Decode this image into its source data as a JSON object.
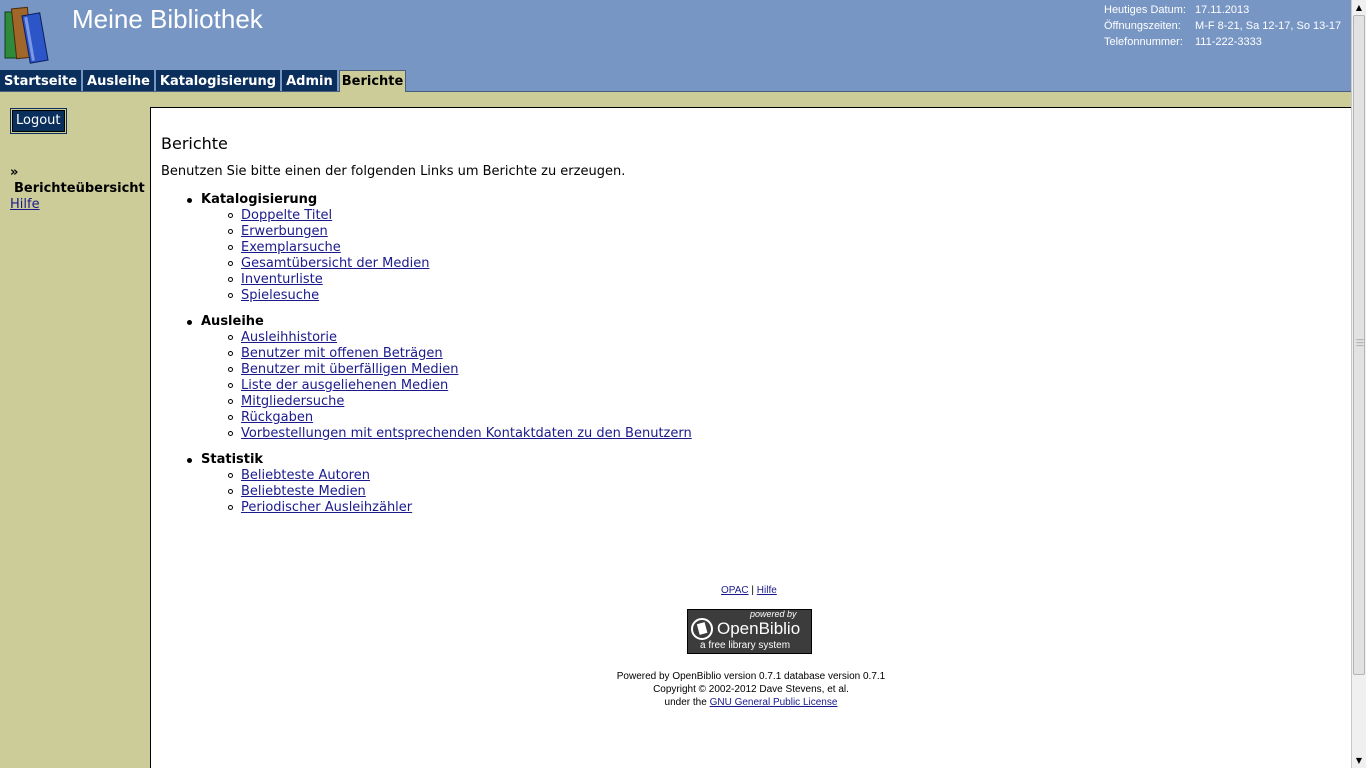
{
  "header": {
    "title": "Meine Bibliothek",
    "info": [
      {
        "label": "Heutiges Datum:",
        "value": "17.11.2013"
      },
      {
        "label": "Öffnungszeiten:",
        "value": "M-F 8-21, Sa 12-17, So 13-17"
      },
      {
        "label": "Telefonnummer:",
        "value": "111-222-3333"
      }
    ],
    "logo_icon": "books-icon"
  },
  "tabs": [
    {
      "label": "Startseite",
      "active": false
    },
    {
      "label": "Ausleihe",
      "active": false
    },
    {
      "label": "Katalogisierung",
      "active": false
    },
    {
      "label": "Admin",
      "active": false
    },
    {
      "label": "Berichte",
      "active": true
    }
  ],
  "sidebar": {
    "logout_label": "Logout",
    "arrow": "»",
    "current": "Berichteübersicht",
    "help_link": "Hilfe"
  },
  "main": {
    "title": "Berichte",
    "intro": "Benutzen Sie bitte einen der folgenden Links um Berichte zu erzeugen.",
    "sections": [
      {
        "heading": "Katalogisierung",
        "links": [
          "Doppelte Titel",
          "Erwerbungen",
          "Exemplarsuche",
          "Gesamtübersicht der Medien",
          "Inventurliste",
          "Spielesuche"
        ]
      },
      {
        "heading": "Ausleihe",
        "links": [
          "Ausleihhistorie",
          "Benutzer mit offenen Beträgen",
          "Benutzer mit überfälligen Medien",
          "Liste der ausgeliehenen Medien",
          "Mitgliedersuche",
          "Rückgaben",
          "Vorbestellungen mit entsprechenden Kontaktdaten zu den Benutzern"
        ]
      },
      {
        "heading": "Statistik",
        "links": [
          "Beliebteste Autoren",
          "Beliebteste Medien",
          "Periodischer Ausleihzähler"
        ]
      }
    ]
  },
  "footer": {
    "link_opac": "OPAC",
    "separator": "|",
    "link_help": "Hilfe",
    "badge_powered": "powered by",
    "badge_name": "OpenBiblio",
    "badge_tagline": "a free library system",
    "powered_line": "Powered by OpenBiblio version 0.7.1 database version 0.7.1",
    "copyright_line": "Copyright © 2002-2012 Dave Stevens, et al.",
    "license_prefix": "under the",
    "license_link": "GNU General Public License"
  },
  "colors": {
    "header_bg": "#7896c4",
    "tab_bg": "#0b2f5d",
    "sidebar_bg": "#cccc99",
    "link": "#1a1a8c"
  }
}
